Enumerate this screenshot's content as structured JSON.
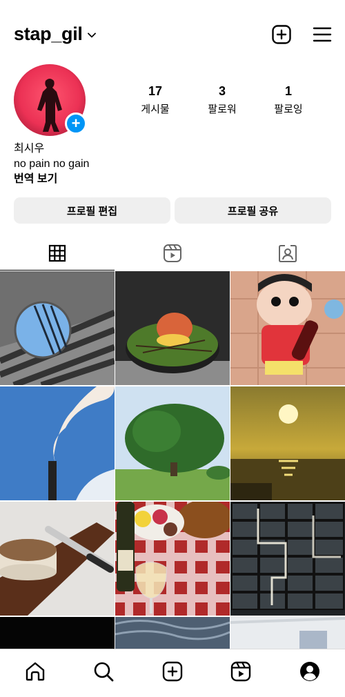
{
  "header": {
    "username": "stap_gil"
  },
  "profile": {
    "stats": {
      "posts_count": "17",
      "posts_label": "게시물",
      "followers_count": "3",
      "followers_label": "팔로워",
      "following_count": "1",
      "following_label": "팔로잉"
    },
    "name": "최시우",
    "bio": "no pain no gain",
    "translate_label": "번역 보기",
    "edit_button": "프로필 편집",
    "share_button": "프로필 공유"
  },
  "tabs": {
    "active": "grid",
    "items": [
      "grid-icon",
      "reels-icon",
      "tagged-icon"
    ]
  },
  "grid": {
    "posts": [
      {
        "subject": "round mirror reflecting sky"
      },
      {
        "subject": "apple on green plate"
      },
      {
        "subject": "cartoon boy with soda bottle"
      },
      {
        "subject": "smokestack steam and blue sky"
      },
      {
        "subject": "large green tree"
      },
      {
        "subject": "sunset over sea"
      },
      {
        "subject": "cheesecake on wooden board"
      },
      {
        "subject": "fruits and wine on checkered cloth"
      },
      {
        "subject": "lit storage lockers"
      },
      {
        "subject": "dark photo"
      },
      {
        "subject": "sea water"
      },
      {
        "subject": "white interior"
      }
    ]
  },
  "bottom_nav": {
    "items": [
      "home-icon",
      "search-icon",
      "create-icon",
      "reels-icon",
      "profile-icon"
    ]
  },
  "colors": {
    "accent": "#0095f6",
    "button_bg": "#efefef"
  }
}
